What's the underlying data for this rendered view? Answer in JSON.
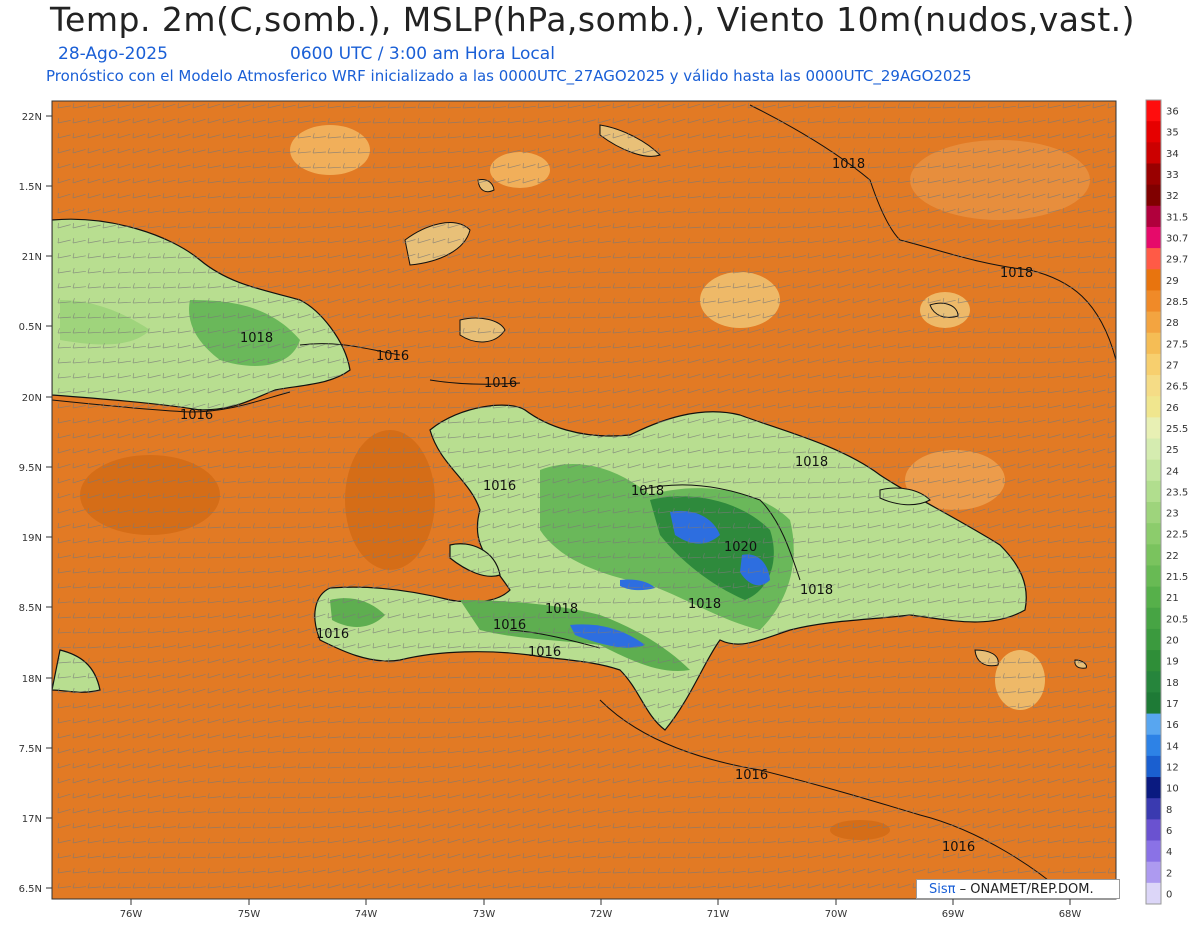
{
  "header": {
    "title": "Temp. 2m(C,somb.), MSLP(hPa,somb.), Viento 10m(nudos,vast.)",
    "date": "28-Ago-2025",
    "time": "0600 UTC / 3:00 am Hora Local",
    "description": "Pronóstico con el Modelo Atmosferico WRF inicializado a las 0000UTC_27AGO2025 y válido hasta las  0000UTC_29AGO2025"
  },
  "axes": {
    "lat_labels": [
      "22N",
      "1.5N",
      "21N",
      "0.5N",
      "20N",
      "9.5N",
      "19N",
      "8.5N",
      "18N",
      "7.5N",
      "17N",
      "6.5N"
    ],
    "lon_labels": [
      "76W",
      "75W",
      "74W",
      "73W",
      "72W",
      "71W",
      "70W",
      "69W",
      "68W"
    ]
  },
  "colorbar": {
    "labels": [
      "36",
      "35",
      "34",
      "33",
      "32",
      "31.5",
      "30.7",
      "29.7",
      "29",
      "28.5",
      "28",
      "27.5",
      "27",
      "26.5",
      "26",
      "25.5",
      "25",
      "24",
      "23.5",
      "23",
      "22.5",
      "22",
      "21.5",
      "21",
      "20.5",
      "20",
      "19",
      "18",
      "17",
      "16",
      "14",
      "12",
      "10",
      "8",
      "6",
      "4",
      "2",
      "0"
    ],
    "colors": [
      "#ff0d0d",
      "#e60000",
      "#cc0000",
      "#990000",
      "#800000",
      "#b0003c",
      "#e60a6a",
      "#ff5a46",
      "#e8740e",
      "#f08a28",
      "#f3a440",
      "#f5bd55",
      "#f7cf6e",
      "#f5dc86",
      "#f0e68e",
      "#e8f0b4",
      "#d5ecb0",
      "#c4e6a0",
      "#b1de8e",
      "#9ed47c",
      "#8ccc6c",
      "#7ac35e",
      "#68ba54",
      "#56b04a",
      "#47a444",
      "#3b9a3e",
      "#2f8e38",
      "#26853c",
      "#1e7a36",
      "#58a6f0",
      "#2d82e6",
      "#1a5fd0",
      "#0a1a80",
      "#3a3ab0",
      "#6a52d0",
      "#8a72e6",
      "#ad9af0",
      "#dcd6f8"
    ]
  },
  "isobars": [
    "1018",
    "1018",
    "1018",
    "1016",
    "1016",
    "1016",
    "1016",
    "1018",
    "1018",
    "1020",
    "1018",
    "1018",
    "1018",
    "1016",
    "1016",
    "1016",
    "1016",
    "1016",
    "1018"
  ],
  "footer": {
    "logo": "Sisπ",
    "org": " – ONAMET/REP.DOM."
  },
  "colors": {
    "ocean": "#e27a24",
    "land_low": "#c9e7a0",
    "land_mid": "#7fc866",
    "land_high": "#2e8a3c",
    "cold_peak": "#2d6ee0",
    "isobar": "#111111",
    "barb": "#7a7a7a"
  }
}
